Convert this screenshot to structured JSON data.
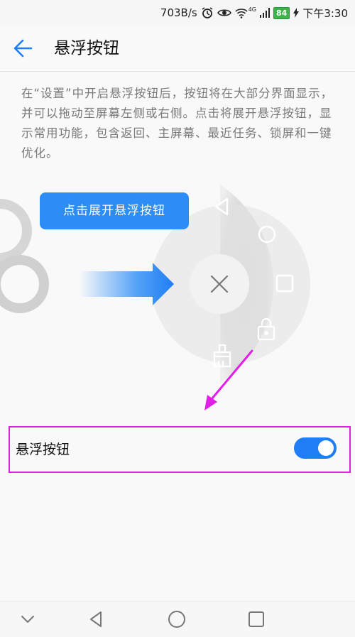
{
  "status_bar": {
    "speed": "703B/s",
    "network_type": "4G",
    "battery": "84",
    "time": "下午3:30",
    "icons": [
      "alarm-icon",
      "eye-icon",
      "wifi-icon",
      "signal-icon",
      "battery-icon",
      "charging-icon"
    ]
  },
  "header": {
    "title": "悬浮按钮",
    "back_icon": "back-arrow-icon"
  },
  "description": "在“设置”中开启悬浮按钮后，按钮将在大部分界面显示，并可以拖动至屏幕左侧或右侧。点击将展开悬浮按钮，显示常用功能，包含返回、主屏幕、最近任务、锁屏和一键优化。",
  "illustration": {
    "tooltip": "点击展开悬浮按钮",
    "menu_icons": [
      "back-triangle-icon",
      "home-circle-icon",
      "recent-square-icon",
      "lock-icon",
      "brush-icon",
      "close-icon"
    ]
  },
  "setting": {
    "label": "悬浮按钮",
    "enabled": true
  },
  "colors": {
    "accent": "#1f7ef5",
    "highlight_annotation": "#e020e6"
  },
  "nav_bar": {
    "icons": [
      "chevron-down-icon",
      "back-triangle-icon",
      "home-circle-icon",
      "recent-square-icon"
    ]
  }
}
